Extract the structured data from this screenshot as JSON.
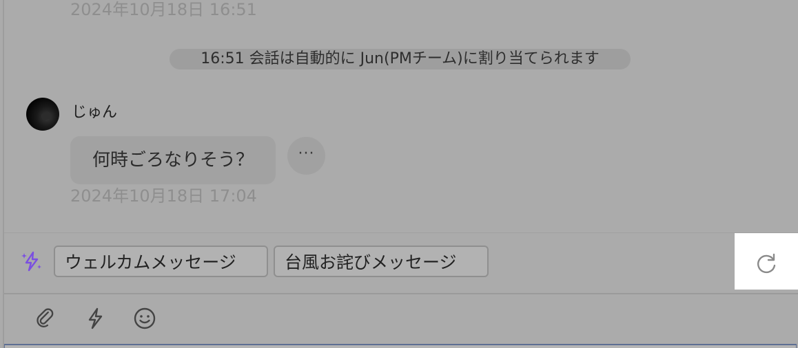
{
  "messages": {
    "previous_timestamp": "2024年10月18日 16:51",
    "system_notice": "16:51 会話は自動的に Jun(PMチーム)に割り当てられます",
    "sender": {
      "name": "じゅん",
      "avatar_icon": "user-avatar"
    },
    "message_text": "何時ごろなりそう？",
    "more_label": "···",
    "message_timestamp": "2024年10月18日 17:04"
  },
  "suggestions": {
    "icon": "sparkle-bolt-icon",
    "items": [
      {
        "label": "ウェルカムメッセージ"
      },
      {
        "label": "台風お詫びメッセージ"
      }
    ],
    "refresh_icon": "refresh-icon"
  },
  "composer_toolbar": {
    "icons": [
      "paperclip-icon",
      "lightning-icon",
      "emoji-icon"
    ]
  },
  "colors": {
    "overlay_gray": "#ababab",
    "accent_purple": "#7b4fe0",
    "input_border": "#5e6f93"
  }
}
